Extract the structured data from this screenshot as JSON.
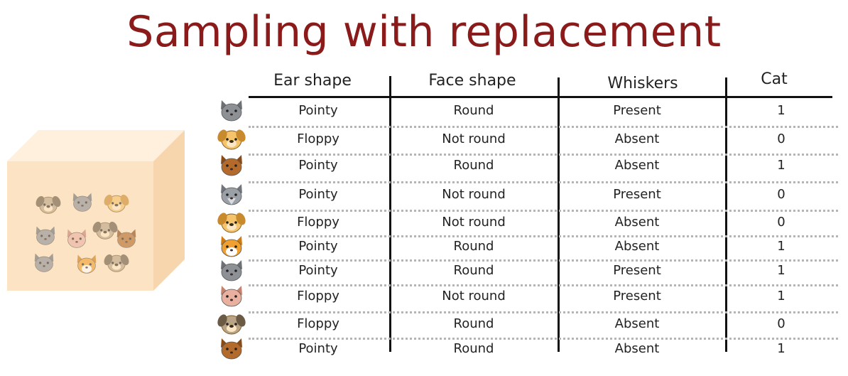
{
  "title": "Sampling with replacement",
  "headers": [
    "Ear shape",
    "Face shape",
    "Whiskers",
    "Cat"
  ],
  "rows": [
    {
      "animal": "cat-gray",
      "ear": "Pointy",
      "face": "Round",
      "whiskers": "Present",
      "cat": "1"
    },
    {
      "animal": "dog-tan",
      "ear": "Floppy",
      "face": "Not round",
      "whiskers": "Absent",
      "cat": "0"
    },
    {
      "animal": "cat-brown",
      "ear": "Pointy",
      "face": "Round",
      "whiskers": "Absent",
      "cat": "1"
    },
    {
      "animal": "wolf-gray",
      "ear": "Pointy",
      "face": "Not round",
      "whiskers": "Present",
      "cat": "0"
    },
    {
      "animal": "dog-tan",
      "ear": "Floppy",
      "face": "Not round",
      "whiskers": "Absent",
      "cat": "0"
    },
    {
      "animal": "cat-orange",
      "ear": "Pointy",
      "face": "Round",
      "whiskers": "Absent",
      "cat": "1"
    },
    {
      "animal": "cat-gray",
      "ear": "Pointy",
      "face": "Round",
      "whiskers": "Present",
      "cat": "1"
    },
    {
      "animal": "cat-pink",
      "ear": "Floppy",
      "face": "Not round",
      "whiskers": "Present",
      "cat": "1"
    },
    {
      "animal": "dog-dark",
      "ear": "Floppy",
      "face": "Round",
      "whiskers": "Absent",
      "cat": "0"
    },
    {
      "animal": "cat-brown",
      "ear": "Pointy",
      "face": "Round",
      "whiskers": "Absent",
      "cat": "1"
    }
  ],
  "colors": {
    "title": "#8b1a1a",
    "box_front": "#fce3c4",
    "box_top": "#fef0dc",
    "box_side": "#f7d6ae"
  }
}
